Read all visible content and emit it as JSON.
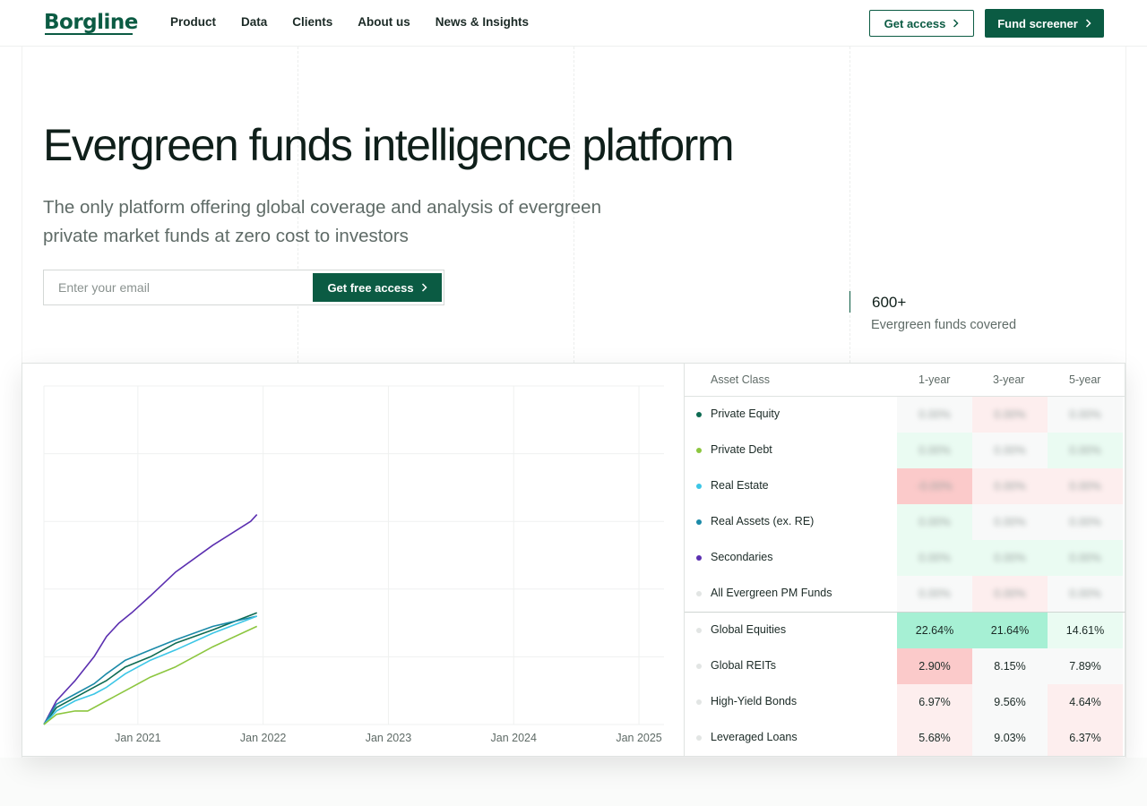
{
  "nav": {
    "logo": "Borgline",
    "menu": [
      "Product",
      "Data",
      "Clients",
      "About us",
      "News & Insights"
    ],
    "get_access": "Get access",
    "fund_screener": "Fund screener"
  },
  "hero": {
    "title": "Evergreen funds intelligence platform",
    "subtitle": "The only platform offering global coverage and analysis of evergreen private market funds at zero cost to investors",
    "email_placeholder": "Enter your email",
    "cta": "Get free access"
  },
  "stat": {
    "value": "600+",
    "label": "Evergreen funds covered"
  },
  "colors": {
    "brand": "#0b5b43",
    "private_equity": "#0e6b52",
    "private_debt": "#8cc63f",
    "real_estate": "#3cc6e6",
    "real_assets": "#1b8aa8",
    "secondaries": "#5b2fb0",
    "benchmark_dot": "#e2e5e4",
    "green_strong": "#a6f0d4",
    "green_light": "#eafbf2",
    "red_strong": "#fbcaca",
    "red_light": "#fdeeee",
    "neutral": "#f8f9f9"
  },
  "chart_data": {
    "type": "line",
    "x_ticks": [
      "Jan 2021",
      "Jan 2022",
      "Jan 2023",
      "Jan 2024",
      "Jan 2025"
    ],
    "x_range": [
      2020.25,
      2025.2
    ],
    "y_range": [
      0,
      1
    ],
    "grid": true,
    "series": [
      {
        "name": "Secondaries",
        "x": [
          2020.25,
          2020.35,
          2020.5,
          2020.65,
          2020.75,
          2020.85,
          2020.95,
          2021.1,
          2021.3,
          2021.6,
          2021.9,
          2021.95
        ],
        "y": [
          0,
          0.07,
          0.13,
          0.2,
          0.26,
          0.3,
          0.33,
          0.38,
          0.45,
          0.53,
          0.6,
          0.62
        ]
      },
      {
        "name": "Private Equity",
        "x": [
          2020.25,
          2020.35,
          2020.5,
          2020.65,
          2020.75,
          2020.9,
          2021.1,
          2021.3,
          2021.6,
          2021.95
        ],
        "y": [
          0,
          0.05,
          0.08,
          0.11,
          0.13,
          0.17,
          0.2,
          0.24,
          0.28,
          0.33
        ]
      },
      {
        "name": "Real Assets (ex. RE)",
        "x": [
          2020.25,
          2020.35,
          2020.5,
          2020.65,
          2020.75,
          2020.9,
          2021.1,
          2021.3,
          2021.6,
          2021.95
        ],
        "y": [
          0,
          0.06,
          0.09,
          0.12,
          0.15,
          0.19,
          0.22,
          0.25,
          0.29,
          0.32
        ]
      },
      {
        "name": "Real Estate",
        "x": [
          2020.25,
          2020.35,
          2020.5,
          2020.65,
          2020.75,
          2020.9,
          2021.1,
          2021.3,
          2021.6,
          2021.95
        ],
        "y": [
          0,
          0.04,
          0.07,
          0.09,
          0.11,
          0.15,
          0.19,
          0.22,
          0.27,
          0.32
        ]
      },
      {
        "name": "Private Debt",
        "x": [
          2020.25,
          2020.35,
          2020.5,
          2020.6,
          2020.75,
          2020.9,
          2021.1,
          2021.3,
          2021.6,
          2021.95
        ],
        "y": [
          0,
          0.03,
          0.04,
          0.04,
          0.07,
          0.1,
          0.14,
          0.17,
          0.23,
          0.29
        ]
      }
    ]
  },
  "table": {
    "headers": [
      "Asset Class",
      "1-year",
      "3-year",
      "5-year"
    ],
    "rows": [
      {
        "name": "Private Equity",
        "dot": "#0e6b52",
        "values": [
          "0.00%",
          "0.00%",
          "0.00%"
        ],
        "tones": [
          "neutral",
          "red_light",
          "neutral"
        ],
        "blurred": true
      },
      {
        "name": "Private Debt",
        "dot": "#8cc63f",
        "values": [
          "0.00%",
          "0.00%",
          "0.00%"
        ],
        "tones": [
          "green_light",
          "neutral",
          "green_light"
        ],
        "blurred": true
      },
      {
        "name": "Real Estate",
        "dot": "#3cc6e6",
        "values": [
          "-0.00%",
          "0.00%",
          "0.00%"
        ],
        "tones": [
          "red_strong",
          "red_light",
          "red_light"
        ],
        "blurred": true
      },
      {
        "name": "Real Assets (ex. RE)",
        "dot": "#1b8aa8",
        "values": [
          "0.00%",
          "0.00%",
          "0.00%"
        ],
        "tones": [
          "green_light",
          "neutral",
          "neutral"
        ],
        "blurred": true
      },
      {
        "name": "Secondaries",
        "dot": "#5b2fb0",
        "values": [
          "0.00%",
          "0.00%",
          "0.00%"
        ],
        "tones": [
          "green_light",
          "green_light",
          "green_light"
        ],
        "blurred": true
      },
      {
        "name": "All Evergreen PM Funds",
        "dot": "#e2e5e4",
        "values": [
          "0.00%",
          "0.00%",
          "0.00%"
        ],
        "tones": [
          "neutral",
          "red_light",
          "neutral"
        ],
        "blurred": true
      },
      {
        "name": "Global Equities",
        "dot": "#e2e5e4",
        "values": [
          "22.64%",
          "21.64%",
          "14.61%"
        ],
        "tones": [
          "green_strong",
          "green_strong",
          "green_light"
        ],
        "blurred": false
      },
      {
        "name": "Global REITs",
        "dot": "#e2e5e4",
        "values": [
          "2.90%",
          "8.15%",
          "7.89%"
        ],
        "tones": [
          "red_strong",
          "neutral",
          "neutral"
        ],
        "blurred": false
      },
      {
        "name": "High-Yield Bonds",
        "dot": "#e2e5e4",
        "values": [
          "6.97%",
          "9.56%",
          "4.64%"
        ],
        "tones": [
          "red_light",
          "neutral",
          "red_light"
        ],
        "blurred": false
      },
      {
        "name": "Leveraged Loans",
        "dot": "#e2e5e4",
        "values": [
          "5.68%",
          "9.03%",
          "6.37%"
        ],
        "tones": [
          "red_light",
          "neutral",
          "red_light"
        ],
        "blurred": false
      }
    ]
  }
}
